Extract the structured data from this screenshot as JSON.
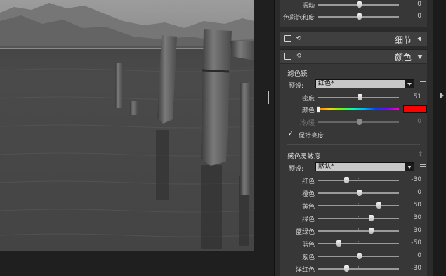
{
  "top_sliders": [
    {
      "label": "振动",
      "value": "0",
      "pos": 0.5
    },
    {
      "label": "色彩饱和度",
      "value": "0",
      "pos": 0.5
    }
  ],
  "sections": {
    "detail": {
      "title": "细节"
    },
    "color": {
      "title": "颜色"
    }
  },
  "filter": {
    "title": "滤色镜",
    "preset_label": "预设:",
    "preset_value": "红色*",
    "density": {
      "label": "密度",
      "value": "51",
      "pos": 0.51
    },
    "color": {
      "label": "颜色",
      "hue_pos": 0.0,
      "swatch_color": "#ff0000"
    },
    "warmth": {
      "label": "冷/暖",
      "value": "0",
      "pos": 0.5,
      "disabled": true
    },
    "keep_luminance": {
      "label": "保持亮度",
      "checked": true
    }
  },
  "sensitivity": {
    "title": "感色灵敏度",
    "preset_label": "预设:",
    "preset_value": "默认*",
    "channels": [
      {
        "label": "红色",
        "value": "-30",
        "pos": 0.35
      },
      {
        "label": "橙色",
        "value": "0",
        "pos": 0.5
      },
      {
        "label": "黄色",
        "value": "50",
        "pos": 0.75
      },
      {
        "label": "绿色",
        "value": "30",
        "pos": 0.65
      },
      {
        "label": "蓝绿色",
        "value": "30",
        "pos": 0.65
      },
      {
        "label": "蓝色",
        "value": "-50",
        "pos": 0.25
      },
      {
        "label": "紫色",
        "value": "0",
        "pos": 0.5
      },
      {
        "label": "洋红色",
        "value": "-30",
        "pos": 0.35
      }
    ]
  }
}
